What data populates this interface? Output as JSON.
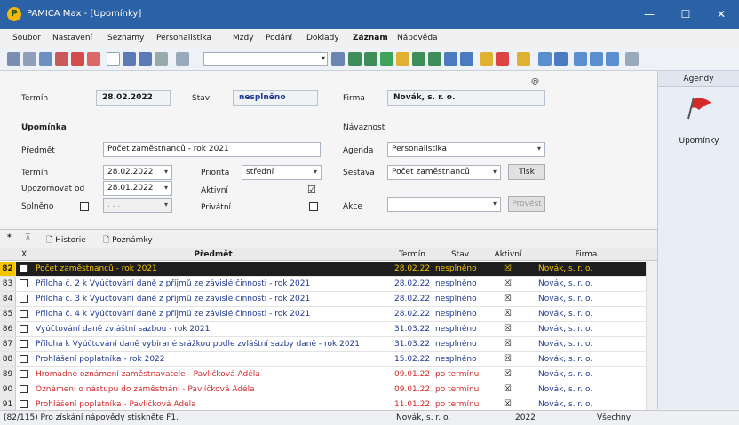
{
  "window": {
    "title": "PAMICA Max - [Upomínky]",
    "minimize": "—",
    "maximize": "☐",
    "close": "✕"
  },
  "menu": [
    "Soubor",
    "Nastavení",
    "Seznamy",
    "Personalistika",
    "Mzdy",
    "Podání",
    "Doklady",
    "Záznam",
    "Nápověda"
  ],
  "header": {
    "termin_label": "Termín",
    "termin_value": "28.02.2022",
    "stav_label": "Stav",
    "stav_value": "nesplněno",
    "firma_label": "Firma",
    "firma_value": "Novák, s. r. o.",
    "corner_icon": "@"
  },
  "upominka": {
    "section": "Upomínka",
    "predmet_label": "Předmět",
    "predmet_value": "Počet zaměstnanců - rok 2021",
    "termin_label": "Termín",
    "termin_value": "28.02.2022",
    "upozornovat_label": "Upozorňovat od",
    "upozornovat_value": "28.01.2022",
    "splneno_label": "Splněno",
    "splneno_date": ". . .",
    "priorita_label": "Priorita",
    "priorita_value": "střední",
    "aktivni_label": "Aktivní",
    "aktivni_check": "☑",
    "privatni_label": "Privátní"
  },
  "navaznost": {
    "section": "Návaznost",
    "agenda_label": "Agenda",
    "agenda_value": "Personalistika",
    "sestava_label": "Sestava",
    "sestava_value": "Počet zaměstnanců",
    "tisk_button": "Tisk",
    "akce_label": "Akce",
    "akce_value": "",
    "provest_button": "Provést"
  },
  "sidebar": {
    "header": "Agendy",
    "item": "Upomínky"
  },
  "tabs": {
    "star": "*",
    "filter": "⊼",
    "historie": "Historie",
    "poznamky": "Poznámky"
  },
  "columns": {
    "x": "X",
    "predmet": "Předmět",
    "termin": "Termín",
    "stav": "Stav",
    "aktivni": "Aktivní",
    "firma": "Firma"
  },
  "rows": [
    {
      "num": "82",
      "predmet": "Počet zaměstnanců - rok 2021",
      "termin": "28.02.22",
      "stav": "nesplněno",
      "firma": "Novák, s. r. o.",
      "selected": true
    },
    {
      "num": "83",
      "predmet": "Příloha č. 2 k Vyúčtování daně z příjmů ze závislé činnosti - rok 2021",
      "termin": "28.02.22",
      "stav": "nesplněno",
      "firma": "Novák, s. r. o."
    },
    {
      "num": "84",
      "predmet": "Příloha č. 3 k Vyúčtování daně z příjmů ze závislé činnosti - rok 2021",
      "termin": "28.02.22",
      "stav": "nesplněno",
      "firma": "Novák, s. r. o."
    },
    {
      "num": "85",
      "predmet": "Příloha č. 4 k Vyúčtování daně z příjmů ze závislé činnosti - rok 2021",
      "termin": "28.02.22",
      "stav": "nesplněno",
      "firma": "Novák, s. r. o."
    },
    {
      "num": "86",
      "predmet": "Vyúčtování daně zvláštní sazbou - rok 2021",
      "termin": "31.03.22",
      "stav": "nesplněno",
      "firma": "Novák, s. r. o."
    },
    {
      "num": "87",
      "predmet": "Příloha k Vyúčtování daně vybírané srážkou podle zvláštní sazby daně - rok 2021",
      "termin": "31.03.22",
      "stav": "nesplněno",
      "firma": "Novák, s. r. o."
    },
    {
      "num": "88",
      "predmet": "Prohlášení poplatníka - rok 2022",
      "termin": "15.02.22",
      "stav": "nesplněno",
      "firma": "Novák, s. r. o."
    },
    {
      "num": "89",
      "predmet": "Hromadné oznámení zaměstnavatele - Pavlíčková Adéla",
      "termin": "09.01.22",
      "stav": "po termínu",
      "firma": "Novák, s. r. o.",
      "late": true
    },
    {
      "num": "90",
      "predmet": "Oznámení o nástupu do zaměstnání - Pavlíčková Adéla",
      "termin": "09.01.22",
      "stav": "po termínu",
      "firma": "Novák, s. r. o.",
      "late": true
    },
    {
      "num": "91",
      "predmet": "Prohlášení poplatníka - Pavlíčková Adéla",
      "termin": "11.01.22",
      "stav": "po termínu",
      "firma": "Novák, s. r. o.",
      "late": true
    }
  ],
  "status": {
    "hint": "(82/115) Pro získání nápovědy stiskněte F1.",
    "firma": "Novák, s. r. o.",
    "year": "2022",
    "filter": "Všechny"
  },
  "colors": {
    "titlebar": "#2b62a6",
    "selected_row": "#1e1e1e",
    "selected_text": "#f5c400",
    "late": "#d42a2a",
    "blue_text": "#1f3a93"
  }
}
